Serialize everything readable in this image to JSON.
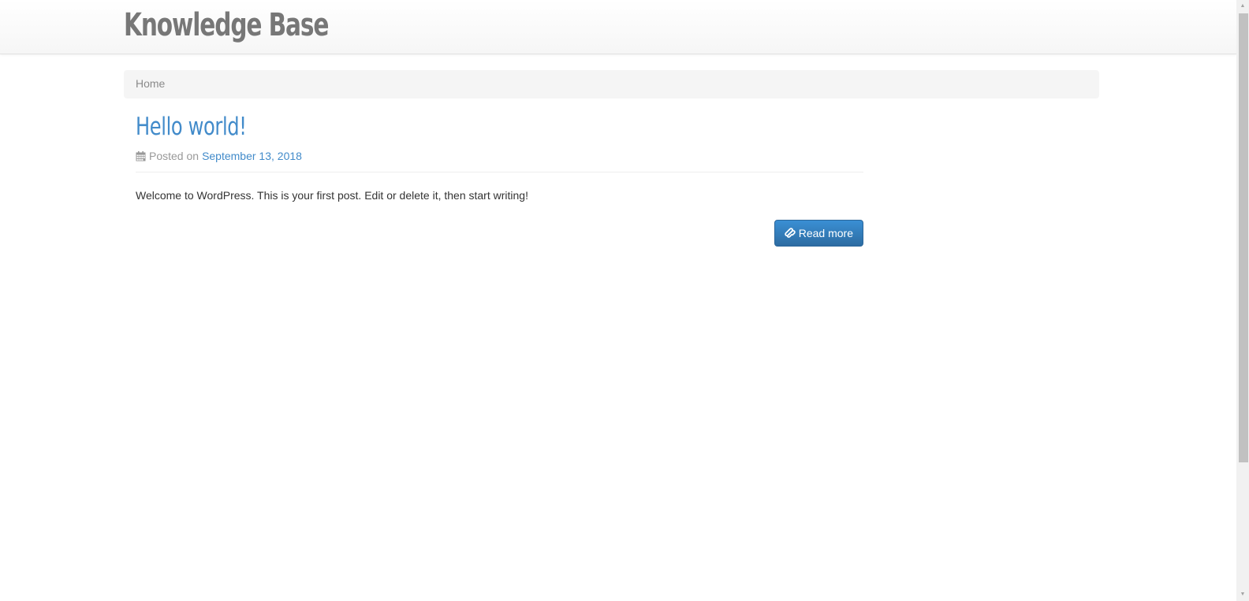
{
  "header": {
    "site_title": "Knowledge Base"
  },
  "breadcrumb": {
    "home_label": "Home"
  },
  "post": {
    "title": "Hello world!",
    "meta_prefix": "Posted on",
    "date": "September 13, 2018",
    "excerpt": "Welcome to WordPress. This is your first post. Edit or delete it, then start writing!",
    "read_more_label": "Read more",
    "meta_icon": "calendar-icon",
    "button_icon": "link-icon"
  },
  "colors": {
    "link": "#428bca",
    "button": "#337ab7",
    "title_gray": "#777777"
  }
}
